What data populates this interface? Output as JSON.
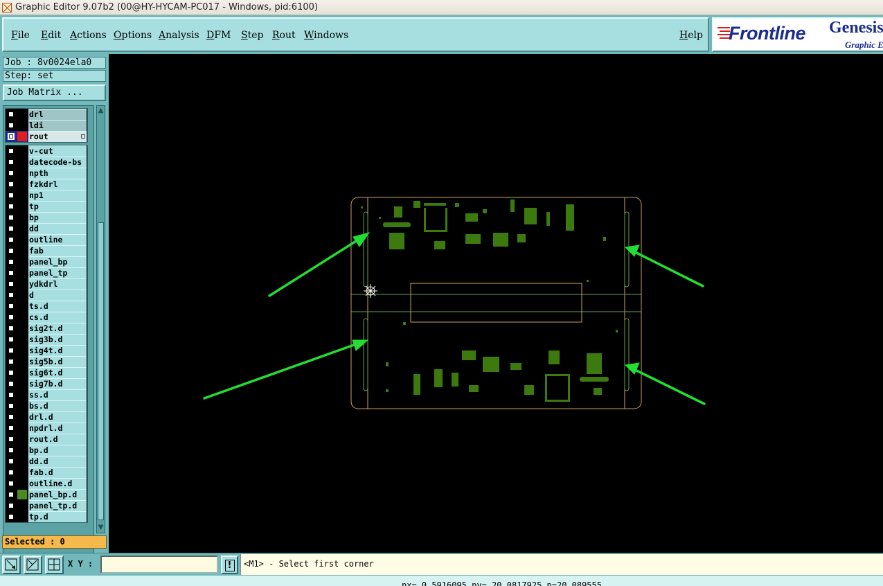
{
  "window": {
    "title": "Graphic Editor 9.07b2 (00@HY-HYCAM-PC017 - Windows, pid:6100)"
  },
  "menu": {
    "items": [
      "File",
      "Edit",
      "Actions",
      "Options",
      "Analysis",
      "DFM",
      "Step",
      "Rout",
      "Windows"
    ],
    "help": "Help"
  },
  "logo": {
    "brand": "Frontline",
    "product": "Genesis",
    "subtitle": "Graphic E"
  },
  "job": {
    "label": "Job : 8v0024ela0",
    "step": "Step: set",
    "matrix_button": "Job Matrix ..."
  },
  "layers": {
    "board_group": [
      {
        "name": "drl",
        "color": "#000000",
        "selected": false
      },
      {
        "name": "ldi",
        "color": "#000000",
        "selected": false
      },
      {
        "name": "rout",
        "color": "#e02020",
        "selected": true
      }
    ],
    "misc_group": [
      {
        "name": "v-cut",
        "color": "#000000"
      },
      {
        "name": "datecode-bs",
        "color": "#000000"
      },
      {
        "name": "npth",
        "color": "#000000"
      },
      {
        "name": "fzkdrl",
        "color": "#000000"
      },
      {
        "name": "np1",
        "color": "#000000"
      },
      {
        "name": "tp",
        "color": "#000000"
      },
      {
        "name": "bp",
        "color": "#000000"
      },
      {
        "name": "dd",
        "color": "#000000"
      },
      {
        "name": "outline",
        "color": "#000000"
      },
      {
        "name": "fab",
        "color": "#000000"
      },
      {
        "name": "panel_bp",
        "color": "#000000"
      },
      {
        "name": "panel_tp",
        "color": "#000000"
      },
      {
        "name": "ydkdrl",
        "color": "#000000"
      },
      {
        "name": "d",
        "color": "#000000"
      },
      {
        "name": "ts.d",
        "color": "#000000"
      },
      {
        "name": "cs.d",
        "color": "#000000"
      },
      {
        "name": "sig2t.d",
        "color": "#000000"
      },
      {
        "name": "sig3b.d",
        "color": "#000000"
      },
      {
        "name": "sig4t.d",
        "color": "#000000"
      },
      {
        "name": "sig5b.d",
        "color": "#000000"
      },
      {
        "name": "sig6t.d",
        "color": "#000000"
      },
      {
        "name": "sig7b.d",
        "color": "#000000"
      },
      {
        "name": "ss.d",
        "color": "#000000"
      },
      {
        "name": "bs.d",
        "color": "#000000"
      },
      {
        "name": "drl.d",
        "color": "#000000"
      },
      {
        "name": "npdrl.d",
        "color": "#000000"
      },
      {
        "name": "rout.d",
        "color": "#000000"
      },
      {
        "name": "bp.d",
        "color": "#000000"
      },
      {
        "name": "dd.d",
        "color": "#000000"
      },
      {
        "name": "fab.d",
        "color": "#000000"
      },
      {
        "name": "outline.d",
        "color": "#000000"
      },
      {
        "name": "panel_bp.d",
        "color": "#4a8a1e"
      },
      {
        "name": "panel_tp.d",
        "color": "#000000"
      },
      {
        "name": "tp.d",
        "color": "#000000"
      }
    ]
  },
  "selected": "Selected : 0",
  "bottom": {
    "xy_label": "X Y :",
    "xy_value": "",
    "bang": "!",
    "prompt": "<M1> - Select first corner",
    "coords": "px= 0.5916095 py= 20.0817925 p=20.089555"
  },
  "colors": {
    "panel": "#73b9bb",
    "field": "#a7dfe1",
    "board_outline": "#c8a064",
    "copper": "#3c7a10",
    "annotation": "#22dd33"
  },
  "icons": {
    "tool1": "zoom-diagonal-icon",
    "tool2": "zoom-cross-icon",
    "tool3": "grid-snap-icon",
    "cursor": "crosshair-cursor-icon"
  }
}
